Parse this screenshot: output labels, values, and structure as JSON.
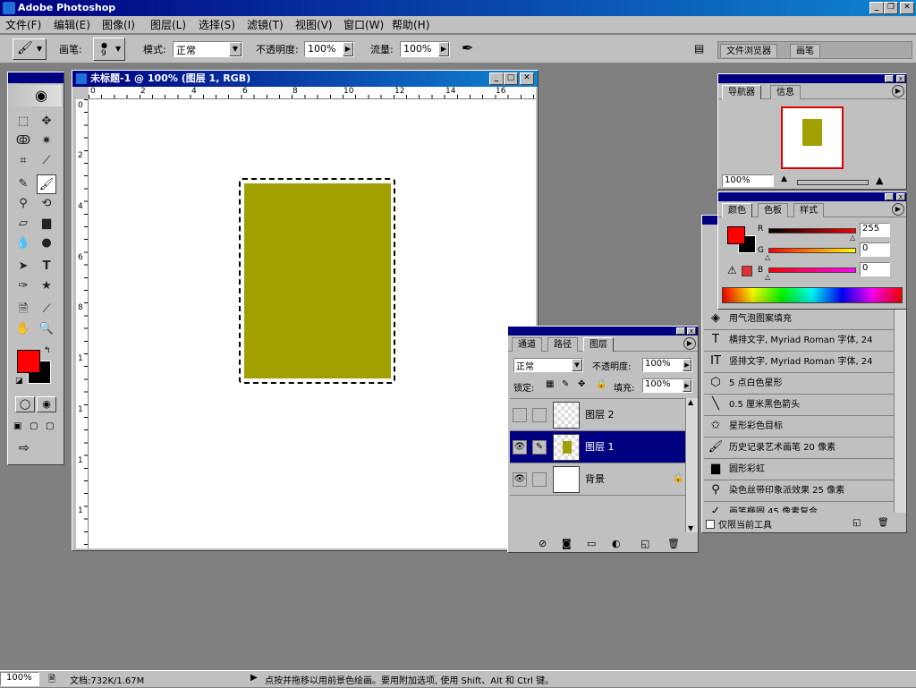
{
  "app": {
    "title": "Adobe Photoshop"
  },
  "menu": [
    "文件(F)",
    "编辑(E)",
    "图像(I)",
    "图层(L)",
    "选择(S)",
    "滤镜(T)",
    "视图(V)",
    "窗口(W)",
    "帮助(H)"
  ],
  "options": {
    "brush_label": "画笔:",
    "brush_size": "9",
    "mode_label": "模式:",
    "mode_value": "正常",
    "opacity_label": "不透明度:",
    "opacity_value": "100%",
    "flow_label": "流量:",
    "flow_value": "100%"
  },
  "wells": {
    "file_browser": "文件浏览器",
    "brushes": "画笔"
  },
  "document": {
    "title": "未标题-1 @ 100% (图层 1, RGB)",
    "ruler_h": [
      "0",
      "2",
      "4",
      "6",
      "8",
      "10",
      "12",
      "14",
      "16"
    ],
    "ruler_v": [
      "0",
      "2",
      "4",
      "6",
      "8",
      "1",
      "1",
      "1",
      "1"
    ],
    "shape_color": "#a0a000"
  },
  "navigator": {
    "tabs": [
      "导航器",
      "信息"
    ],
    "zoom": "100%"
  },
  "color_panel": {
    "tabs": [
      "颜色",
      "色板",
      "样式"
    ],
    "r_label": "R",
    "g_label": "G",
    "b_label": "B",
    "r_value": "255",
    "g_value": "0",
    "b_value": "0",
    "foreground": "#ff0000",
    "background": "#000000"
  },
  "history": {
    "items": [
      "用气泡图案填充",
      "横排文字, Myriad Roman 字体, 24",
      "竖排文字, Myriad Roman 字体, 24",
      "5 点白色星形",
      "0.5 厘米黑色箭头",
      "星形彩色目标",
      "历史记录艺术画笔 20 像素",
      "圆形彩虹",
      "染色丝带印象派效果 25 像素",
      "画笔椭圆 45 像素复合"
    ],
    "checkbox_label": "仅限当前工具"
  },
  "layers_panel": {
    "tabs": [
      "通道",
      "路径",
      "图层"
    ],
    "blend_mode": "正常",
    "opacity_label": "不透明度:",
    "opacity_value": "100%",
    "lock_label": "锁定:",
    "fill_label": "填充:",
    "fill_value": "100%",
    "layers": [
      {
        "name": "图层 2",
        "visible": false,
        "active": false
      },
      {
        "name": "图层 1",
        "visible": true,
        "active": true
      },
      {
        "name": "背景",
        "visible": true,
        "active": false,
        "locked": true
      }
    ]
  },
  "status": {
    "zoom": "100%",
    "doc_info": "文档:732K/1.67M",
    "hint": "点按并拖移以用前景色绘画。要用附加选项, 使用 Shift、Alt 和 Ctrl 键。"
  },
  "toolbox": {
    "foreground": "#ff0000",
    "background": "#000000"
  }
}
